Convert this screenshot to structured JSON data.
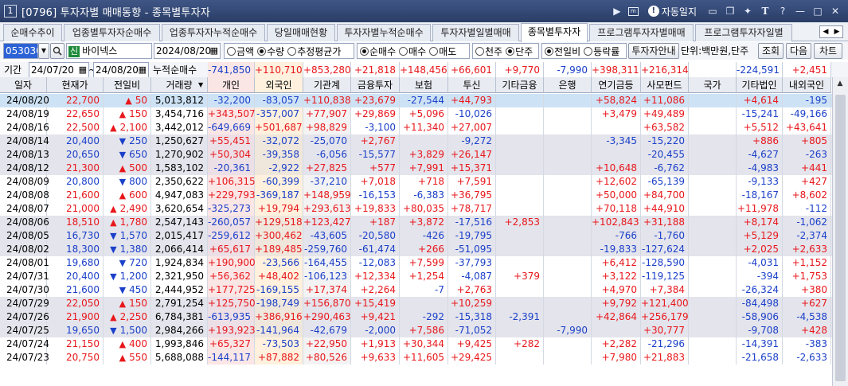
{
  "titlebar": {
    "window_num": "1",
    "title": "[0796] 투자자별 매매동향 - 종목별투자자",
    "auto_label": "자동일지",
    "icons": [
      "play-icon",
      "memo-icon",
      "auto-icon",
      "screen-icon",
      "copy-icon",
      "pin-icon",
      "font-icon",
      "help-icon",
      "minimize-icon",
      "maximize-icon",
      "close-icon"
    ]
  },
  "tabs": [
    "순매수추이",
    "업종별투자자순매수",
    "업종투자자누적순매수",
    "당일매매현황",
    "투자자별누적순매수",
    "투자자별일별매매",
    "종목별투자자",
    "프로그램투자자별매매",
    "프로그램투자자일별"
  ],
  "active_tab": 6,
  "controls": {
    "code": "053030",
    "badge": "신",
    "stock_name": "바이넥스",
    "date": "2024/08/20",
    "radio_amount": [
      "금액",
      "수량",
      "추정평균가"
    ],
    "radio_amount_selected": 1,
    "radio_side": [
      "순매수",
      "매수",
      "매도"
    ],
    "radio_side_selected": 0,
    "radio_unit": [
      "천주",
      "단주"
    ],
    "radio_unit_selected": 1,
    "radio_cmp": [
      "전일비",
      "등락률"
    ],
    "radio_cmp_selected": 0,
    "investor_btn": "투자자안내",
    "unit_label": "단위:백만원,단주",
    "query_btn": "조회",
    "next_btn": "다음",
    "chart_btn": "차트"
  },
  "period": {
    "label": "기간",
    "from": "24/07/20",
    "tilde": "~",
    "to": "24/08/20",
    "cum_label": "누적순매수",
    "totals": [
      "-741,850",
      "+110,710",
      "+853,280",
      "+21,818",
      "+148,456",
      "+66,601",
      "+9,770",
      "-7,990",
      "+398,311",
      "+216,314",
      "",
      "-224,591",
      "+2,451"
    ]
  },
  "columns": [
    "일자",
    "현재가",
    "전일비",
    "거래량",
    "개인",
    "외국인",
    "기관계",
    "금융투자",
    "보험",
    "투신",
    "기타금융",
    "은행",
    "연기금등",
    "사모펀드",
    "국가",
    "기타법인",
    "내외국인"
  ],
  "rows": [
    {
      "date": "24/08/20",
      "price": "22,700",
      "dir": "up",
      "chg": "50",
      "vol": "5,013,812",
      "v": [
        "-32,200",
        "-83,057",
        "+110,838",
        "+23,679",
        "-27,544",
        "+44,793",
        "",
        "",
        "+58,824",
        "+11,086",
        "",
        "+4,614",
        "-195"
      ]
    },
    {
      "date": "24/08/19",
      "price": "22,650",
      "dir": "up",
      "chg": "150",
      "vol": "3,454,716",
      "v": [
        "+343,507",
        "-357,007",
        "+77,907",
        "+29,869",
        "+5,096",
        "-10,026",
        "",
        "",
        "+3,479",
        "+49,489",
        "",
        "-15,241",
        "-49,166"
      ]
    },
    {
      "date": "24/08/16",
      "price": "22,500",
      "dir": "up",
      "chg": "2,100",
      "vol": "3,442,012",
      "v": [
        "-649,669",
        "+501,687",
        "+98,829",
        "-3,100",
        "+11,340",
        "+27,007",
        "",
        "",
        "",
        "+63,582",
        "",
        "+5,512",
        "+43,641"
      ]
    },
    {
      "date": "24/08/14",
      "price": "20,400",
      "dir": "dn",
      "chg": "250",
      "vol": "1,250,627",
      "v": [
        "+55,451",
        "-32,072",
        "-25,070",
        "+2,767",
        "",
        "-9,272",
        "",
        "",
        "-3,345",
        "-15,220",
        "",
        "+886",
        "+805"
      ]
    },
    {
      "date": "24/08/13",
      "price": "20,650",
      "dir": "dn",
      "chg": "650",
      "vol": "1,270,902",
      "v": [
        "+50,304",
        "-39,358",
        "-6,056",
        "-15,577",
        "+3,829",
        "+26,147",
        "",
        "",
        "",
        "-20,455",
        "",
        "-4,627",
        "-263"
      ]
    },
    {
      "date": "24/08/12",
      "price": "21,300",
      "dir": "up",
      "chg": "500",
      "vol": "1,583,102",
      "v": [
        "-20,361",
        "-2,922",
        "+27,825",
        "+577",
        "+7,991",
        "+15,371",
        "",
        "",
        "+10,648",
        "-6,762",
        "",
        "-4,983",
        "+441"
      ]
    },
    {
      "date": "24/08/09",
      "price": "20,800",
      "dir": "dn",
      "chg": "800",
      "vol": "2,350,622",
      "v": [
        "+106,315",
        "-60,399",
        "-37,210",
        "+7,018",
        "+718",
        "+7,591",
        "",
        "",
        "+12,602",
        "-65,139",
        "",
        "-9,133",
        "+427"
      ]
    },
    {
      "date": "24/08/08",
      "price": "21,600",
      "dir": "up",
      "chg": "600",
      "vol": "4,947,083",
      "v": [
        "+229,793",
        "-369,187",
        "+148,959",
        "-16,153",
        "-6,383",
        "+36,795",
        "",
        "",
        "+50,000",
        "+84,700",
        "",
        "-18,167",
        "+8,602"
      ]
    },
    {
      "date": "24/08/07",
      "price": "21,000",
      "dir": "up",
      "chg": "2,490",
      "vol": "3,620,654",
      "v": [
        "-325,273",
        "+19,794",
        "+293,613",
        "+19,833",
        "+80,035",
        "+78,717",
        "",
        "",
        "+70,118",
        "+44,910",
        "",
        "+11,978",
        "-112"
      ]
    },
    {
      "date": "24/08/06",
      "price": "18,510",
      "dir": "up",
      "chg": "1,780",
      "vol": "2,547,143",
      "v": [
        "-260,057",
        "+129,518",
        "+123,427",
        "+187",
        "+3,872",
        "-17,516",
        "+2,853",
        "",
        "+102,843",
        "+31,188",
        "",
        "+8,174",
        "-1,062"
      ]
    },
    {
      "date": "24/08/05",
      "price": "16,730",
      "dir": "dn",
      "chg": "1,570",
      "vol": "2,015,417",
      "v": [
        "-259,612",
        "+300,462",
        "-43,605",
        "-20,580",
        "-426",
        "-19,795",
        "",
        "",
        "-766",
        "-1,760",
        "",
        "+5,129",
        "-2,374"
      ]
    },
    {
      "date": "24/08/02",
      "price": "18,300",
      "dir": "dn",
      "chg": "1,380",
      "vol": "2,066,414",
      "v": [
        "+65,617",
        "+189,485",
        "-259,760",
        "-61,474",
        "+266",
        "-51,095",
        "",
        "",
        "-19,833",
        "-127,624",
        "",
        "+2,025",
        "+2,633"
      ]
    },
    {
      "date": "24/08/01",
      "price": "19,680",
      "dir": "dn",
      "chg": "720",
      "vol": "1,924,834",
      "v": [
        "+190,900",
        "-23,566",
        "-164,455",
        "-12,083",
        "+7,599",
        "-37,793",
        "",
        "",
        "+6,412",
        "-128,590",
        "",
        "-4,031",
        "+1,152"
      ]
    },
    {
      "date": "24/07/31",
      "price": "20,400",
      "dir": "dn",
      "chg": "1,200",
      "vol": "2,321,950",
      "v": [
        "+56,362",
        "+48,402",
        "-106,123",
        "+12,334",
        "+1,254",
        "-4,087",
        "+379",
        "",
        "+3,122",
        "-119,125",
        "",
        "-394",
        "+1,753"
      ]
    },
    {
      "date": "24/07/30",
      "price": "21,600",
      "dir": "dn",
      "chg": "450",
      "vol": "2,444,952",
      "v": [
        "+177,725",
        "-169,155",
        "+17,374",
        "+2,264",
        "-7",
        "+2,763",
        "",
        "",
        "+4,970",
        "+7,384",
        "",
        "-26,324",
        "+380"
      ]
    },
    {
      "date": "24/07/29",
      "price": "22,050",
      "dir": "up",
      "chg": "150",
      "vol": "2,791,254",
      "v": [
        "+125,750",
        "-198,749",
        "+156,870",
        "+15,419",
        "",
        "+10,259",
        "",
        "",
        "+9,792",
        "+121,400",
        "",
        "-84,498",
        "+627"
      ]
    },
    {
      "date": "24/07/26",
      "price": "21,900",
      "dir": "up",
      "chg": "2,250",
      "vol": "6,784,381",
      "v": [
        "-613,935",
        "+386,916",
        "+290,463",
        "+9,421",
        "-292",
        "-15,318",
        "-2,391",
        "",
        "+42,864",
        "+256,179",
        "",
        "-58,906",
        "-4,538"
      ]
    },
    {
      "date": "24/07/25",
      "price": "19,650",
      "dir": "dn",
      "chg": "1,500",
      "vol": "2,984,266",
      "v": [
        "+193,923",
        "-141,964",
        "-42,679",
        "-2,000",
        "+7,586",
        "-71,052",
        "",
        "-7,990",
        "",
        "+30,777",
        "",
        "-9,708",
        "+428"
      ]
    },
    {
      "date": "24/07/24",
      "price": "21,150",
      "dir": "up",
      "chg": "400",
      "vol": "1,993,846",
      "v": [
        "+65,327",
        "-73,503",
        "+22,950",
        "+1,913",
        "+30,344",
        "+9,425",
        "+282",
        "",
        "+2,282",
        "-21,296",
        "",
        "-14,391",
        "-383"
      ]
    },
    {
      "date": "24/07/23",
      "price": "20,750",
      "dir": "up",
      "chg": "550",
      "vol": "5,688,088",
      "v": [
        "-144,117",
        "+87,882",
        "+80,526",
        "+9,633",
        "+11,605",
        "+29,425",
        "",
        "",
        "+7,980",
        "+21,883",
        "",
        "-21,658",
        "-2,633"
      ]
    }
  ],
  "colors": {
    "up": "#e8171b",
    "down": "#1b40c9",
    "selected_row": "#cde3f5",
    "shade": "#e4e4ec",
    "retail": "#fbe6e6",
    "foreign": "#fff1dd",
    "inst": "#f3f3f3"
  }
}
